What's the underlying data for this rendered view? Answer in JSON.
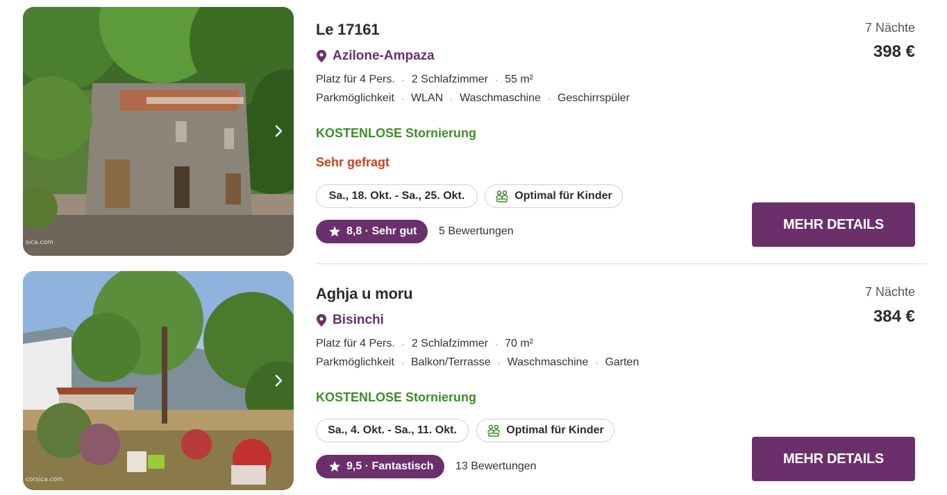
{
  "colors": {
    "brand": "#6b2f6b",
    "free_cancellation": "#3f8c2a",
    "high_demand": "#c9421a"
  },
  "listings": [
    {
      "title": "Le 17161",
      "location": "Azilone-Ampaza",
      "features_line1": [
        "Platz für 4 Pers.",
        "2 Schlafzimmer",
        "55 m²"
      ],
      "features_line2": [
        "Parkmöglichkeit",
        "WLAN",
        "Waschmaschine",
        "Geschirrspüler"
      ],
      "cancellation": "KOSTENLOSE Stornierung",
      "demand": "Sehr gefragt",
      "dates": "Sa., 18. Okt. - Sa., 25. Okt.",
      "kids_label": "Optimal für Kinder",
      "rating": "8,8 · Sehr gut",
      "reviews": "5 Bewertungen",
      "nights": "7 Nächte",
      "price": "398 €",
      "cta": "MEHR DETAILS",
      "photo_watermark": "sica.com",
      "photo_icon": "stone-house-photo"
    },
    {
      "title": "Aghja u moru",
      "location": "Bisinchi",
      "features_line1": [
        "Platz für 4 Pers.",
        "2 Schlafzimmer",
        "70 m²"
      ],
      "features_line2": [
        "Parkmöglichkeit",
        "Balkon/Terrasse",
        "Waschmaschine",
        "Garten"
      ],
      "cancellation": "KOSTENLOSE Stornierung",
      "dates": "Sa., 4. Okt. - Sa., 11. Okt.",
      "kids_label": "Optimal für Kinder",
      "rating": "9,5 · Fantastisch",
      "reviews": "13 Bewertungen",
      "nights": "7 Nächte",
      "price": "384 €",
      "cta": "MEHR DETAILS",
      "photo_watermark": "corsica.com",
      "photo_icon": "garden-house-photo"
    }
  ]
}
